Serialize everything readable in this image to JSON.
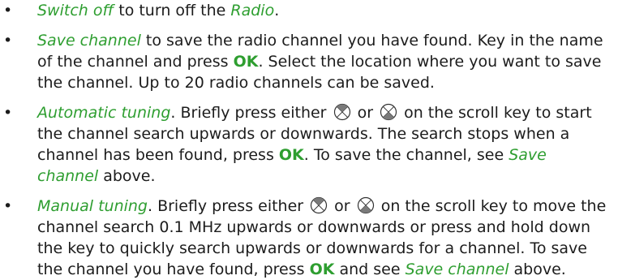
{
  "items": [
    {
      "term": "Switch off",
      "text1": " to turn off the ",
      "term2": "Radio",
      "text2": "."
    },
    {
      "term": "Save channel",
      "text1": " to save the radio channel you have found. Key in the name of the channel and press ",
      "key": "OK",
      "text2": ". Select the location where you want to save the channel. Up to 20 radio channels can be saved."
    },
    {
      "term": "Automatic tuning",
      "text1": ". Briefly press either ",
      "text_or": " or ",
      "text2": " on the scroll key to start the channel search upwards or downwards. The search stops when a channel has been found, press ",
      "key": "OK",
      "text3": ". To save the channel, see ",
      "ref": "Save channel",
      "text4": " above."
    },
    {
      "term": "Manual tuning",
      "text1": ". Briefly press either ",
      "text_or": " or ",
      "text2": " on the scroll key to move the channel search 0.1 MHz upwards or downwards or press and hold down the key to quickly search upwards or downwards for a channel. To save the channel you have found, press ",
      "key": "OK",
      "text3": " and see ",
      "ref": "Save channel",
      "text4": " above."
    }
  ],
  "icons": {
    "scroll_up": "scroll-up-icon",
    "scroll_down": "scroll-down-icon"
  },
  "colors": {
    "accent": "#2e9e30",
    "text": "#1c1c1c"
  }
}
